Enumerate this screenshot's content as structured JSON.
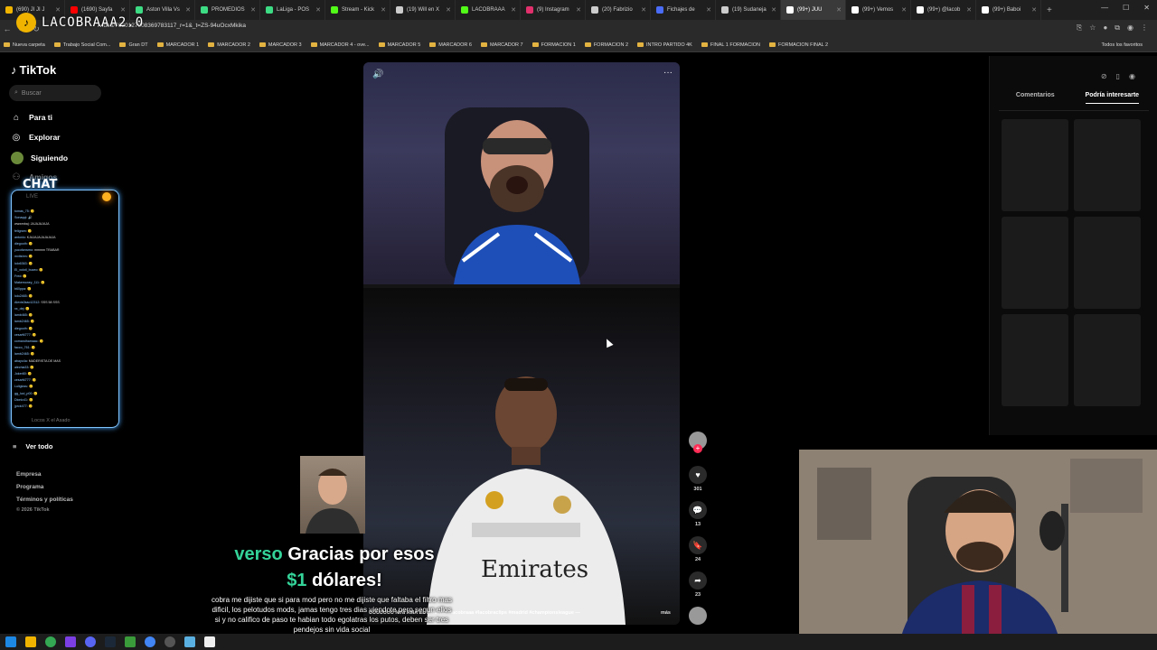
{
  "browser": {
    "tabs": [
      {
        "label": "(690) JI JI J",
        "color": "#f0b400"
      },
      {
        "label": "(1690) Sayfa",
        "color": "#ff0000"
      },
      {
        "label": "Aston Villa Vs",
        "color": "#3ddc84"
      },
      {
        "label": "PROMEDIOS",
        "color": "#3ddc84"
      },
      {
        "label": "LaLiga - POS",
        "color": "#3ddc84"
      },
      {
        "label": "Stream - Kick",
        "color": "#53fc18"
      },
      {
        "label": "(19) Will en X",
        "color": "#cccccc"
      },
      {
        "label": "LACOBRAAA",
        "color": "#53fc18"
      },
      {
        "label": "(9) Instagram",
        "color": "#e1306c"
      },
      {
        "label": "(20) Fabrizio",
        "color": "#cccccc"
      },
      {
        "label": "Fichajes de",
        "color": "#4a6cf7"
      },
      {
        "label": "(19) Sudaneja",
        "color": "#cccccc"
      },
      {
        "label": "(99+) JUU",
        "color": "#ffffff",
        "active": true
      },
      {
        "label": "(99+) Vemos",
        "color": "#ffffff"
      },
      {
        "label": "(99+) @lacob",
        "color": "#ffffff"
      },
      {
        "label": "(99+) Baboi",
        "color": "#ffffff"
      }
    ],
    "url": "/video/7620127908369783117_r=1&_t=ZS-94uOcxMkika",
    "bookmarks": [
      "Nueva carpeta",
      "Trabajo Social Com...",
      "Gran DT",
      "MARCADOR 1",
      "MARCADOR 2",
      "MARCADOR 3",
      "MARCADOR 4 - ove...",
      "MARCADOR 5",
      "MARCADOR 6",
      "MARCADOR 7",
      "FORMACION 1",
      "FORMACION 2",
      "INTRO PARTIDO 4K",
      "FINAL 1 FORMACION",
      "FORMACION FINAL 2"
    ],
    "bookmarks_right": "Todos los favoritos"
  },
  "overlay": {
    "brand": "LACOBRAAA2.0",
    "chat_title": "CHAT"
  },
  "sidebar": {
    "logo": "TikTok",
    "search_placeholder": "Buscar",
    "nav": [
      "Para ti",
      "Explorar",
      "Siguiendo",
      "Amigos"
    ],
    "live_label": "LIVE",
    "see_all": "Ver todo",
    "footer": [
      "Empresa",
      "Programa",
      "Términos y políticas",
      "© 2026 TikTok"
    ]
  },
  "chat_lines": [
    {
      "u": "tomás_75",
      "m": ": 🙂"
    },
    {
      "u": "Sonaqqi",
      "m": ": 🔊"
    },
    {
      "u": "",
      "m": "wwwmbaj: JAJAJAJAJA"
    },
    {
      "u": "feligram",
      "m": ": 🙂"
    },
    {
      "u": "antonio",
      "m": ": KJAJAJAJAJAJAJA"
    },
    {
      "u": "diegooth",
      "m": ": 🙂"
    },
    {
      "u": "yucofcnwmo",
      "m": ": mmmm TRABAR"
    },
    {
      "u": "mxttshm",
      "m": ": 🙂"
    },
    {
      "u": "lolo6363",
      "m": ": 🙂"
    },
    {
      "u": "El_xolotl_buceo",
      "m": ": 🙂"
    },
    {
      "u": "Fred",
      "m": ": 🙂"
    },
    {
      "u": "Makemoney_111",
      "m": ": 🙂"
    },
    {
      "u": "b60ppa",
      "m": ": 🙂"
    },
    {
      "u": "lolo2465",
      "m": ": 🙂"
    },
    {
      "u": "Alexis0kao12312",
      "m": ": SSS 58 SSS"
    },
    {
      "u": "xx_dej",
      "m": ": 🙂"
    },
    {
      "u": "lamb465",
      "m": ": 🙂"
    },
    {
      "u": "lamb2465",
      "m": ": 🙂"
    },
    {
      "u": "diegooth",
      "m": ": 🙂"
    },
    {
      "u": "cesarM777",
      "m": ": 🙂"
    },
    {
      "u": "comandhamaac",
      "m": ": 🙂"
    },
    {
      "u": "facco_761",
      "m": ": 🙂"
    },
    {
      "u": "lamb2465",
      "m": ": 🙂"
    },
    {
      "u": "abayo4a",
      "m": ": MADERISTA DE MAS"
    },
    {
      "u": "alechia33",
      "m": ": 🙂"
    },
    {
      "u": "Joker80",
      "m": ": 🙂"
    },
    {
      "u": "cesarM777",
      "m": ": 🙂"
    },
    {
      "u": "Luligloss",
      "m": ": 🙂"
    },
    {
      "u": "gg_luci_p00",
      "m": ": 🙂"
    },
    {
      "u": "Dionic41",
      "m": ": 🙂"
    },
    {
      "u": "jprck477",
      "m": ": 🙂"
    }
  ],
  "chat_footer": "Locos X el Asado",
  "video": {
    "caption": "UUUUUUU NINI AMA EL MADRID #lacobraaa #lacobraclips #madrid #championsleague —",
    "more": "más",
    "likes": "301",
    "comments": "13",
    "saves": "24",
    "shares": "23"
  },
  "right_panel": {
    "tabs": [
      "Comentarios",
      "Podría interesarte"
    ],
    "active_tab": 1
  },
  "donation": {
    "donor": "verso",
    "text1": "Gracias por esos",
    "amount": "$1",
    "text2": "dólares!",
    "message": "cobra me dijiste que si para mod pero no me dijiste que faltaba el filtro mas dificil, los pelotudos mods, jamas tengo tres dias viendote pero segun ellos si y no califico de paso te habian todo egolatras los putos, deben ser tres pendejos sin vida social"
  },
  "colors": {
    "accent": "#fe2c55",
    "donation_green": "#34d399",
    "chat_glow": "#4aa8ff"
  }
}
